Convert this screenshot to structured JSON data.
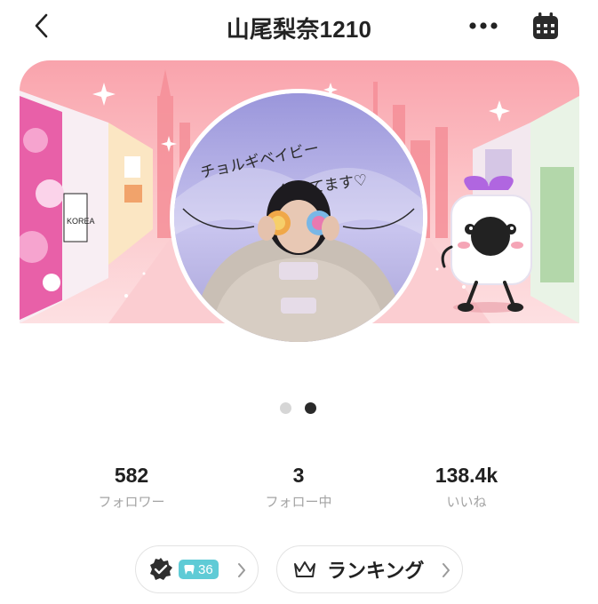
{
  "header": {
    "title": "山尾梨奈1210",
    "back_icon": "chevron-left-icon",
    "more_icon": "more-horizontal-icon",
    "calendar_icon": "calendar-icon"
  },
  "banner": {
    "sign_text": "KOREA",
    "caption_line1": "チョルギベイビー",
    "caption_line2": "集めてます♡"
  },
  "pagination": {
    "count": 2,
    "active_index": 1
  },
  "stats": [
    {
      "value": "582",
      "label": "フォロワー"
    },
    {
      "value": "3",
      "label": "フォロー中"
    },
    {
      "value": "138.4k",
      "label": "いいね"
    }
  ],
  "badge_button": {
    "count": "36",
    "icon": "verified-badge-icon"
  },
  "ranking_button": {
    "label": "ランキング",
    "icon": "crown-icon"
  },
  "colors": {
    "banner_pink": "#f9a3ac",
    "badge_teal": "#5fcbd6",
    "text_dark": "#202020",
    "text_muted": "#a4a4a4"
  }
}
